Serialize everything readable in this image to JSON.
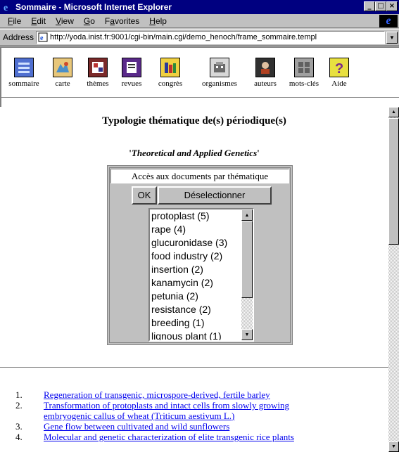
{
  "window": {
    "title": "Sommaire - Microsoft Internet Explorer",
    "buttons": [
      "_",
      "□",
      "×"
    ]
  },
  "menu": [
    "File",
    "Edit",
    "View",
    "Go",
    "Favorites",
    "Help"
  ],
  "address": {
    "label": "Address",
    "url": "http://yoda.inist.fr:9001/cgi-bin/main.cgi/demo_henoch/frame_sommaire.templ"
  },
  "nav": [
    {
      "label": "sommaire",
      "icon": "summary-icon"
    },
    {
      "label": "carte",
      "icon": "map-icon"
    },
    {
      "label": "thèmes",
      "icon": "themes-icon"
    },
    {
      "label": "revues",
      "icon": "journals-icon"
    },
    {
      "label": "congrès",
      "icon": "conferences-icon"
    },
    {
      "label": "organismes",
      "icon": "organizations-icon"
    },
    {
      "label": "auteurs",
      "icon": "authors-icon"
    },
    {
      "label": "mots-clés",
      "icon": "keywords-icon"
    },
    {
      "label": "Aide",
      "icon": "help-icon"
    }
  ],
  "page": {
    "title": "Typologie thématique de(s) périodique(s)",
    "journal": "Theoretical and Applied Genetics",
    "panel_header": "Accès aux documents par thématique",
    "ok_label": "OK",
    "deselect_label": "Déselectionner"
  },
  "themes": [
    "protoplast (5)",
    "rape (4)",
    "glucuronidase (3)",
    "food industry (2)",
    "insertion (2)",
    "kanamycin (2)",
    "petunia (2)",
    "resistance (2)",
    "breeding (1)",
    "lignous plant (1)"
  ],
  "results": [
    {
      "num": "1.",
      "lines": [
        "Regeneration of transgenic, microspore-derived, fertile barley"
      ]
    },
    {
      "num": "2.",
      "lines": [
        "Transformation of protoplasts and intact cells from slowly growing",
        "embryogenic callus of wheat (Triticum aestivum L.)"
      ]
    },
    {
      "num": "3.",
      "lines": [
        "Gene flow between cultivated and wild sunflowers"
      ]
    },
    {
      "num": "4.",
      "lines": [
        "Molecular and genetic characterization of elite transgenic rice plants"
      ]
    }
  ]
}
